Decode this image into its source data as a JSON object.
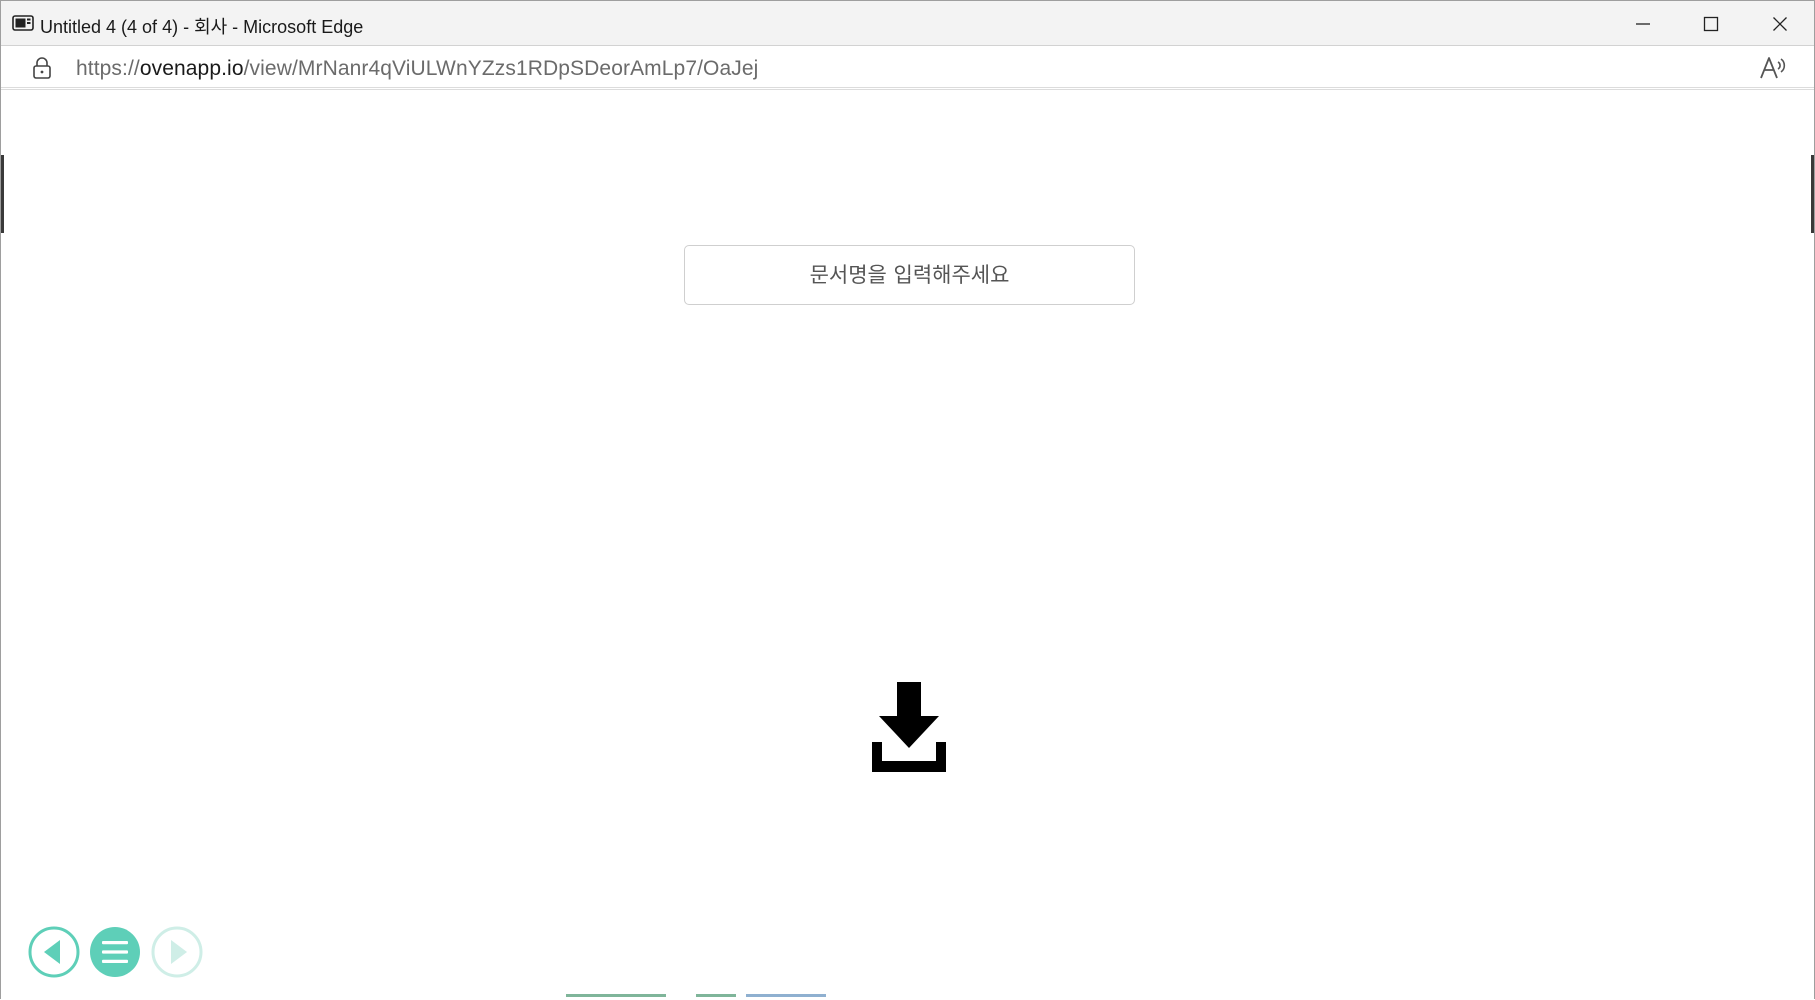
{
  "window": {
    "title": "Untitled 4 (4 of 4) - 회사 - Microsoft Edge",
    "controls": {
      "minimize_icon": "minimize-icon",
      "maximize_icon": "maximize-icon",
      "close_icon": "close-icon"
    }
  },
  "address_bar": {
    "scheme": "https://",
    "host": "ovenapp.io",
    "path": "/view/MrNanr4qViULWnYZzs1RDpSDeorAmLp7/OaJej",
    "lock_icon": "lock-icon",
    "read_aloud_icon": "read-aloud-icon"
  },
  "page": {
    "document_name_placeholder": "문서명을 입력해주세요",
    "document_name_value": "",
    "download_icon": "download-icon"
  },
  "bottom_nav": {
    "prev_icon": "prev-page-icon",
    "menu_icon": "menu-icon",
    "next_icon": "next-page-icon",
    "accent_color": "#5ecfb8",
    "disabled_color": "#cfeee7"
  }
}
